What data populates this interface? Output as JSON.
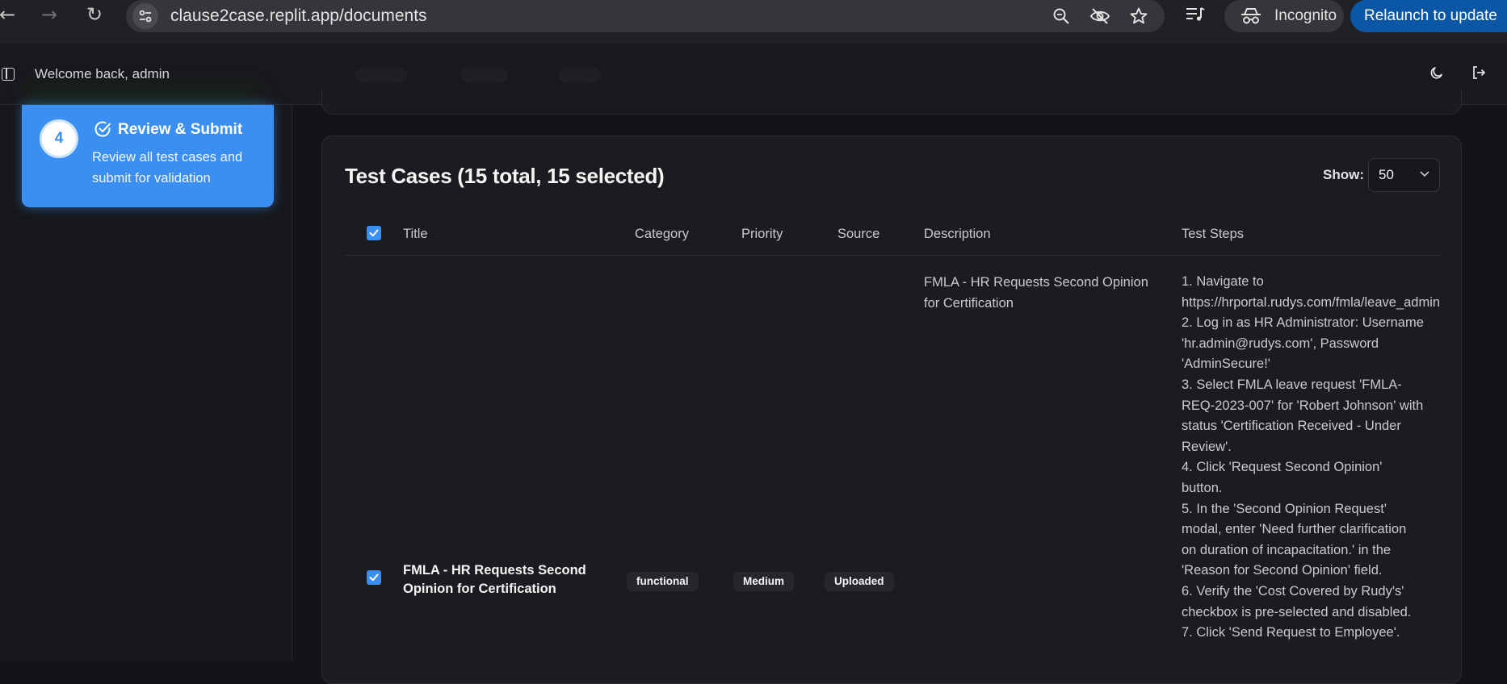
{
  "browser": {
    "url": "clause2case.replit.app/documents",
    "incognito_label": "Incognito",
    "relaunch_label": "Relaunch to update"
  },
  "header": {
    "welcome": "Welcome back, admin"
  },
  "step": {
    "number": "4",
    "title": "Review & Submit",
    "description": "Review all test cases and submit for validation"
  },
  "test_cases": {
    "title": "Test Cases (15 total, 15 selected)",
    "show_label": "Show:",
    "show_value": "50",
    "columns": [
      "Title",
      "Category",
      "Priority",
      "Source",
      "Description",
      "Test Steps"
    ],
    "rows": [
      {
        "selected": true,
        "title": "FMLA - HR Requests Second Opinion for Certification",
        "category": "functional",
        "priority": "Medium",
        "source": "Uploaded",
        "description": "FMLA - HR Requests Second Opinion for Certification",
        "steps": "1. Navigate to https://hrportal.rudys.com/fmla/leave_admin\n2. Log in as HR Administrator: Username 'hr.admin@rudys.com', Password 'AdminSecure!'\n3. Select FMLA leave request 'FMLA-REQ-2023-007' for 'Robert Johnson' with status 'Certification Received - Under Review'.\n4. Click 'Request Second Opinion' button.\n5. In the 'Second Opinion Request' modal, enter 'Need further clarification on duration of incapacitation.' in the 'Reason for Second Opinion' field.\n6. Verify the 'Cost Covered by Rudy's' checkbox is pre-selected and disabled.\n7. Click 'Send Request to Employee'."
      }
    ]
  }
}
